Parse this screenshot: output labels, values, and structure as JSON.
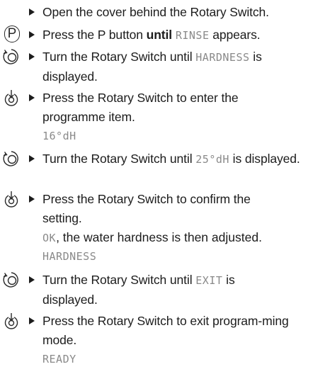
{
  "steps": [
    {
      "icon": "none",
      "parts": [
        {
          "t": "Open the cover behind the Rotary Switch."
        }
      ]
    },
    {
      "icon": "p-button-icon",
      "parts": [
        {
          "t": "Press the P button "
        },
        {
          "t": "until",
          "b": true
        },
        {
          "t": " "
        },
        {
          "t": "RINSE",
          "lcd": true
        },
        {
          "t": " appears."
        }
      ]
    },
    {
      "icon": "rotary-turn-icon",
      "parts": [
        {
          "t": "Turn the Rotary Switch until "
        },
        {
          "t": "HARDNESS",
          "lcd": true
        },
        {
          "t": " is displayed."
        }
      ]
    },
    {
      "icon": "rotary-press-icon",
      "parts": [
        {
          "t": "Press the Rotary Switch to enter the programme item."
        }
      ],
      "lines": [
        {
          "t": "16°dH",
          "lcd": true
        }
      ]
    },
    {
      "icon": "rotary-turn-icon",
      "parts": [
        {
          "t": "Turn the Rotary Switch until "
        },
        {
          "t": "25°dH",
          "lcd": true
        },
        {
          "t": " is displayed."
        }
      ]
    },
    {
      "icon": "rotary-press-icon",
      "parts": [
        {
          "t": "Press the Rotary Switch to confirm the setting."
        }
      ],
      "lines": [
        {
          "parts": [
            {
              "t": "OK",
              "lcd": true
            },
            {
              "t": ", the water hardness is then adjusted."
            }
          ]
        },
        {
          "t": "HARDNESS",
          "lcd": true
        }
      ]
    },
    {
      "icon": "rotary-turn-icon",
      "parts": [
        {
          "t": "Turn the Rotary Switch until "
        },
        {
          "t": "EXIT",
          "lcd": true
        },
        {
          "t": " is displayed."
        }
      ]
    },
    {
      "icon": "rotary-press-icon",
      "parts": [
        {
          "t": "Press the Rotary Switch to exit program-ming mode."
        }
      ],
      "lines": [
        {
          "t": "READY",
          "lcd": true
        }
      ]
    }
  ]
}
